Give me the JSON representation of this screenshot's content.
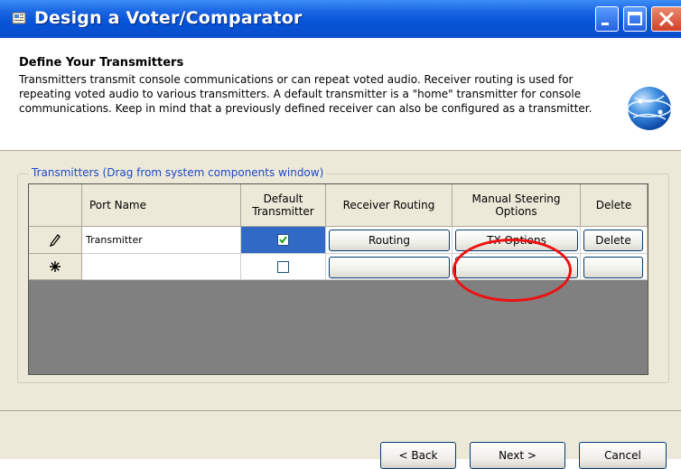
{
  "window": {
    "title": "Design a Voter/Comparator",
    "icon": "wizard-app-icon"
  },
  "header": {
    "title": "Define Your Transmitters",
    "description": "Transmitters transmit console communications or can repeat voted audio.  Receiver routing is used for repeating voted audio to various transmitters.  A default transmitter is a \"home\" transmitter for console communications.  Keep in mind that a previously defined receiver can also be configured as a transmitter.",
    "icon": "globe-icon"
  },
  "group": {
    "legend": "Transmitters (Drag from system components window)"
  },
  "grid": {
    "columns": {
      "port_name": "Port Name",
      "default_tx_1": "Default",
      "default_tx_2": "Transmitter",
      "receiver_routing": "Receiver Routing",
      "manual_steering_1": "Manual Steering",
      "manual_steering_2": "Options",
      "delete": "Delete"
    },
    "rows": [
      {
        "indicator": "pencil-edit-icon",
        "port_name": "Transmitter",
        "default_checked": true,
        "routing_label": "Routing",
        "tx_options_label": "TX Options",
        "delete_label": "Delete"
      },
      {
        "indicator": "new-row-star-icon",
        "port_name": "",
        "default_checked": false,
        "routing_label": "",
        "tx_options_label": "",
        "delete_label": ""
      }
    ]
  },
  "buttons": {
    "back": "< Back",
    "next": "Next >",
    "cancel": "Cancel"
  },
  "colors": {
    "titlebar": "#0553d6",
    "highlight": "#e11111",
    "selection": "#316ac5"
  }
}
